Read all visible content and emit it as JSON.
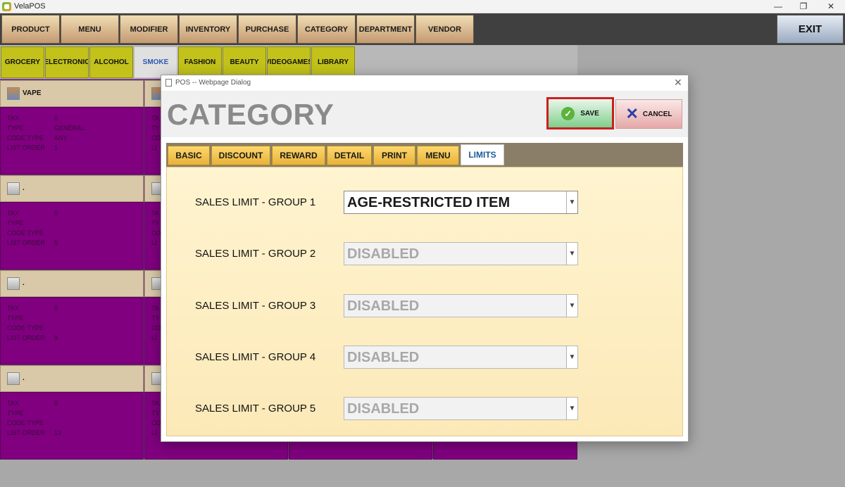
{
  "window": {
    "title": "VelaPOS",
    "minimize": "—",
    "maximize": "❐",
    "close": "✕"
  },
  "topnav": {
    "items": [
      "PRODUCT",
      "MENU",
      "MODIFIER",
      "INVENTORY",
      "PURCHASE",
      "CATEGORY",
      "DEPARTMENT",
      "VENDOR"
    ],
    "exit": "EXIT"
  },
  "categories": {
    "items": [
      "GROCERY",
      "ELECTRONIC",
      "ALCOHOL",
      "SMOKE",
      "FASHION",
      "BEAUTY",
      "VIDEOGAMES",
      "LIBRARY"
    ],
    "active": "SMOKE"
  },
  "grid": {
    "cells": [
      {
        "name": "VAPE",
        "tax_label": "TAX",
        "tax": "0",
        "type_label": "TYPE",
        "type": "GENERAL",
        "code_type_label": "CODE TYPE",
        "code_type": "ANY",
        "list_order_label": "LIST ORDER",
        "list_order": "1"
      },
      {
        "name": ".",
        "tax_label": "TAX",
        "tax": "0",
        "type_label": "TYPE",
        "type": "",
        "code_type_label": "CODE TYPE",
        "code_type": "",
        "list_order_label": "LIST ORDER",
        "list_order": "5"
      },
      {
        "name": ".",
        "tax_label": "TAX",
        "tax": "0",
        "type_label": "TYPE",
        "type": "",
        "code_type_label": "CODE TYPE",
        "code_type": "",
        "list_order_label": "LIST ORDER",
        "list_order": "9"
      },
      {
        "name": ".",
        "tax_label": "TAX",
        "tax": "0",
        "type_label": "TYPE",
        "type": "",
        "code_type_label": "CODE TYPE",
        "code_type": "",
        "list_order_label": "LIST ORDER",
        "list_order": "13"
      }
    ],
    "second_column": {
      "tax_label": "TA",
      "type_label": "TY",
      "code_type_label": "CO",
      "list_order_label": "LI"
    }
  },
  "dialog": {
    "title": "POS -- Webpage Dialog",
    "close": "✕",
    "heading": "CATEGORY",
    "save": "SAVE",
    "cancel": "CANCEL",
    "tabs": [
      "BASIC",
      "DISCOUNT",
      "REWARD",
      "DETAIL",
      "PRINT",
      "MENU",
      "LIMITS"
    ],
    "active_tab": "LIMITS",
    "limits": [
      {
        "label": "SALES LIMIT - GROUP 1",
        "value": "AGE-RESTRICTED ITEM",
        "enabled": true
      },
      {
        "label": "SALES LIMIT - GROUP 2",
        "value": "DISABLED",
        "enabled": false
      },
      {
        "label": "SALES LIMIT - GROUP 3",
        "value": "DISABLED",
        "enabled": false
      },
      {
        "label": "SALES LIMIT - GROUP 4",
        "value": "DISABLED",
        "enabled": false
      },
      {
        "label": "SALES LIMIT - GROUP 5",
        "value": "DISABLED",
        "enabled": false
      }
    ]
  },
  "colors": {
    "nav_button": "#c49a70",
    "category_button": "#c2c21a",
    "grid_body": "#800080",
    "save_highlight": "#cc1f1f",
    "panel_background": "#fce9b8"
  }
}
